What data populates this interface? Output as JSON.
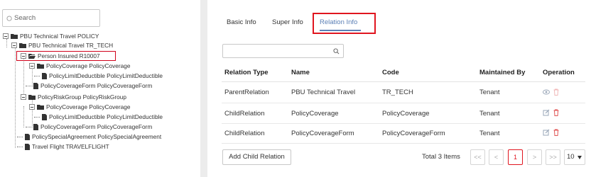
{
  "search": {
    "placeholder": "Search"
  },
  "tree": {
    "nodes": [
      {
        "label": "PBU Technical Travel POLICY"
      },
      {
        "label": "PBU Technical Travel TR_TECH"
      },
      {
        "label": "Person Insured R10007"
      },
      {
        "label": "PolicyCoverage PolicyCoverage"
      },
      {
        "label": "PolicyLimitDeductible PolicyLimitDeductible"
      },
      {
        "label": "PolicyCoverageForm PolicyCoverageForm"
      },
      {
        "label": "PolicyRiskGroup PolicyRiskGroup"
      },
      {
        "label": "PolicyCoverage PolicyCoverage"
      },
      {
        "label": "PolicyLimitDeductible PolicyLimitDeductible"
      },
      {
        "label": "PolicyCoverageForm PolicyCoverageForm"
      },
      {
        "label": "PolicySpecialAgreement PolicySpecialAgreement"
      },
      {
        "label": "Travel Flight TRAVELFLIGHT"
      }
    ]
  },
  "tabs": [
    {
      "label": "Basic Info"
    },
    {
      "label": "Super Info"
    },
    {
      "label": "Relation Info"
    }
  ],
  "table": {
    "headers": [
      "Relation Type",
      "Name",
      "Code",
      "Maintained By",
      "Operation"
    ],
    "rows": [
      {
        "type": "ParentRelation",
        "name": "PBU Technical Travel",
        "code": "TR_TECH",
        "maintained": "Tenant"
      },
      {
        "type": "ChildRelation",
        "name": "PolicyCoverage",
        "code": "PolicyCoverage",
        "maintained": "Tenant"
      },
      {
        "type": "ChildRelation",
        "name": "PolicyCoverageForm",
        "code": "PolicyCoverageForm",
        "maintained": "Tenant"
      }
    ]
  },
  "footer": {
    "add_button": "Add Child Relation",
    "total": "Total 3 Items",
    "pagination": {
      "first": "<<",
      "prev": "<",
      "current": "1",
      "next": ">",
      "last": ">>",
      "page_size": "10"
    }
  },
  "colors": {
    "accent": "#5b7fb5",
    "highlight": "#e0151f",
    "delete": "#e8a0a0"
  },
  "icons": [
    "search-icon",
    "folder-icon",
    "file-icon",
    "eye-icon",
    "edit-icon",
    "delete-icon"
  ]
}
